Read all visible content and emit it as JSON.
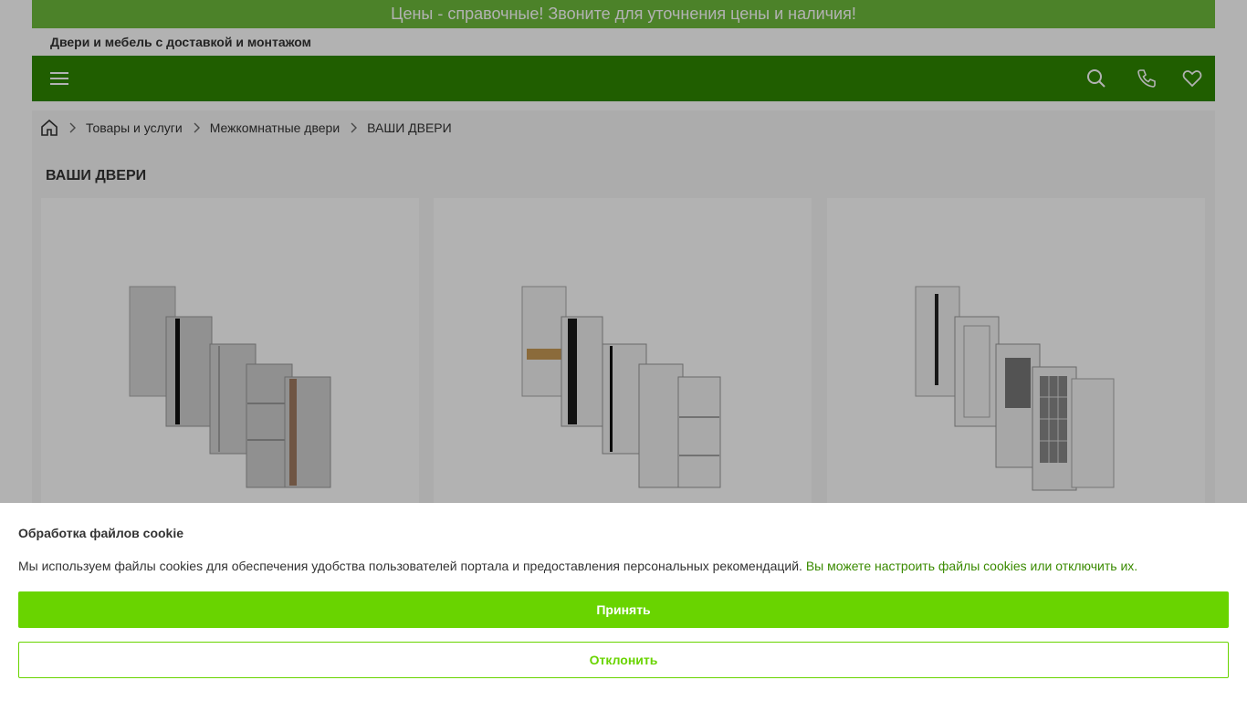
{
  "notice_bar": {
    "text": "Цены - справочные! Звоните для уточнения цены и наличия!"
  },
  "header": {
    "tagline": "Двери и мебель с доставкой и монтажом"
  },
  "navbar": {
    "icons": [
      "menu-icon",
      "search-icon",
      "phone-icon",
      "heart-icon"
    ]
  },
  "breadcrumbs": {
    "home_icon": "home-icon",
    "items": [
      "Товары и услуги",
      "Межкомнатные двери",
      "ВАШИ ДВЕРИ"
    ]
  },
  "page": {
    "title": "ВАШИ ДВЕРИ"
  },
  "products": [
    {
      "image": "door-collection-grey"
    },
    {
      "image": "door-collection-white-modern"
    },
    {
      "image": "door-collection-white-classic"
    }
  ],
  "cookie_banner": {
    "title": "Обработка файлов cookie",
    "text": "Мы используем файлы cookies для обеспечения удобства пользователей портала и предоставления персональных рекомендаций.",
    "link_text": "Вы можете настроить файлы cookies или отключить их.",
    "accept_label": "Принять",
    "decline_label": "Отклонить"
  },
  "colors": {
    "brand_green": "#2f8700",
    "notice_green": "#6dbb3b",
    "accent": "#69d400"
  }
}
